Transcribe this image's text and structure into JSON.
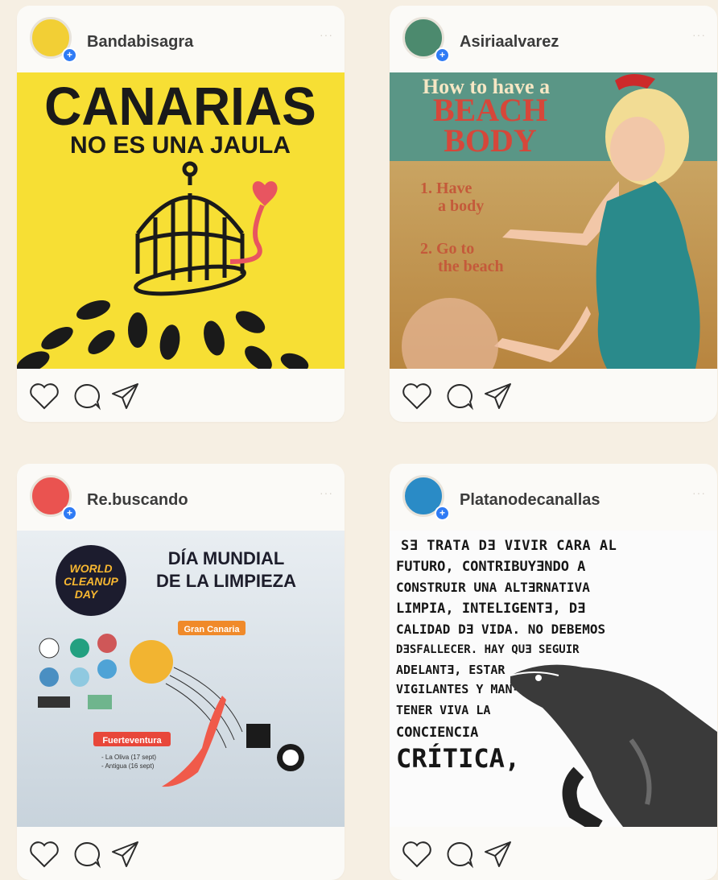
{
  "posts": [
    {
      "username": "Bandabisagra",
      "avatar_color": "#f2cf35",
      "image": {
        "text_line1": "CANARIAS",
        "text_line2": "NO ES UNA JAULA",
        "bg": "#f7df34"
      }
    },
    {
      "username": "Asiriaalvarez",
      "avatar_color": "#4c8a6e",
      "image": {
        "text_line1": "How to have a",
        "text_line2": "BEACH",
        "text_line3": "BODY",
        "item1": "1. Have",
        "item1b": "a body",
        "item2": "2. Go to",
        "item2b": "the beach"
      }
    },
    {
      "username": "Re.buscando",
      "avatar_color": "#ea5350",
      "image": {
        "title1": "DÍA MUNDIAL",
        "title2": "DE LA LIMPIEZA",
        "badge1": "WORLD",
        "badge2": "CLEANUP",
        "badge3": "DAY",
        "region1": "Gran Canaria",
        "region2": "Fuerteventura",
        "sub_ft1": "- La Oliva (17 sept)",
        "sub_ft2": "- Antigua (16 sept)"
      }
    },
    {
      "username": "Platanodecanallas",
      "avatar_color": "#2a8bc6",
      "image": {
        "lines": [
          "SƎ TRATA DƎ VIVIR CARA AL",
          "FUTURO, CONTRIBUYƎNDO A",
          "CONSTRUIR UNA ALTƎRNATIVA",
          "LIMPIA, INTELIGENTƎ, DƎ",
          "CALIDAD DƎ VIDA. NO DEBEMOS",
          "DƎSFALLECER. HAY QUƎ SEGUIR",
          "ADELANTƎ,         ESTAR",
          "VIGILANTES          Y MAN-",
          "TENER VIVA              LA",
          "CONCIENCIA",
          "CRÍTICA,"
        ]
      }
    }
  ],
  "icons": [
    "heart-icon",
    "comment-icon",
    "share-icon",
    "more-icon",
    "follow-plus-icon"
  ]
}
